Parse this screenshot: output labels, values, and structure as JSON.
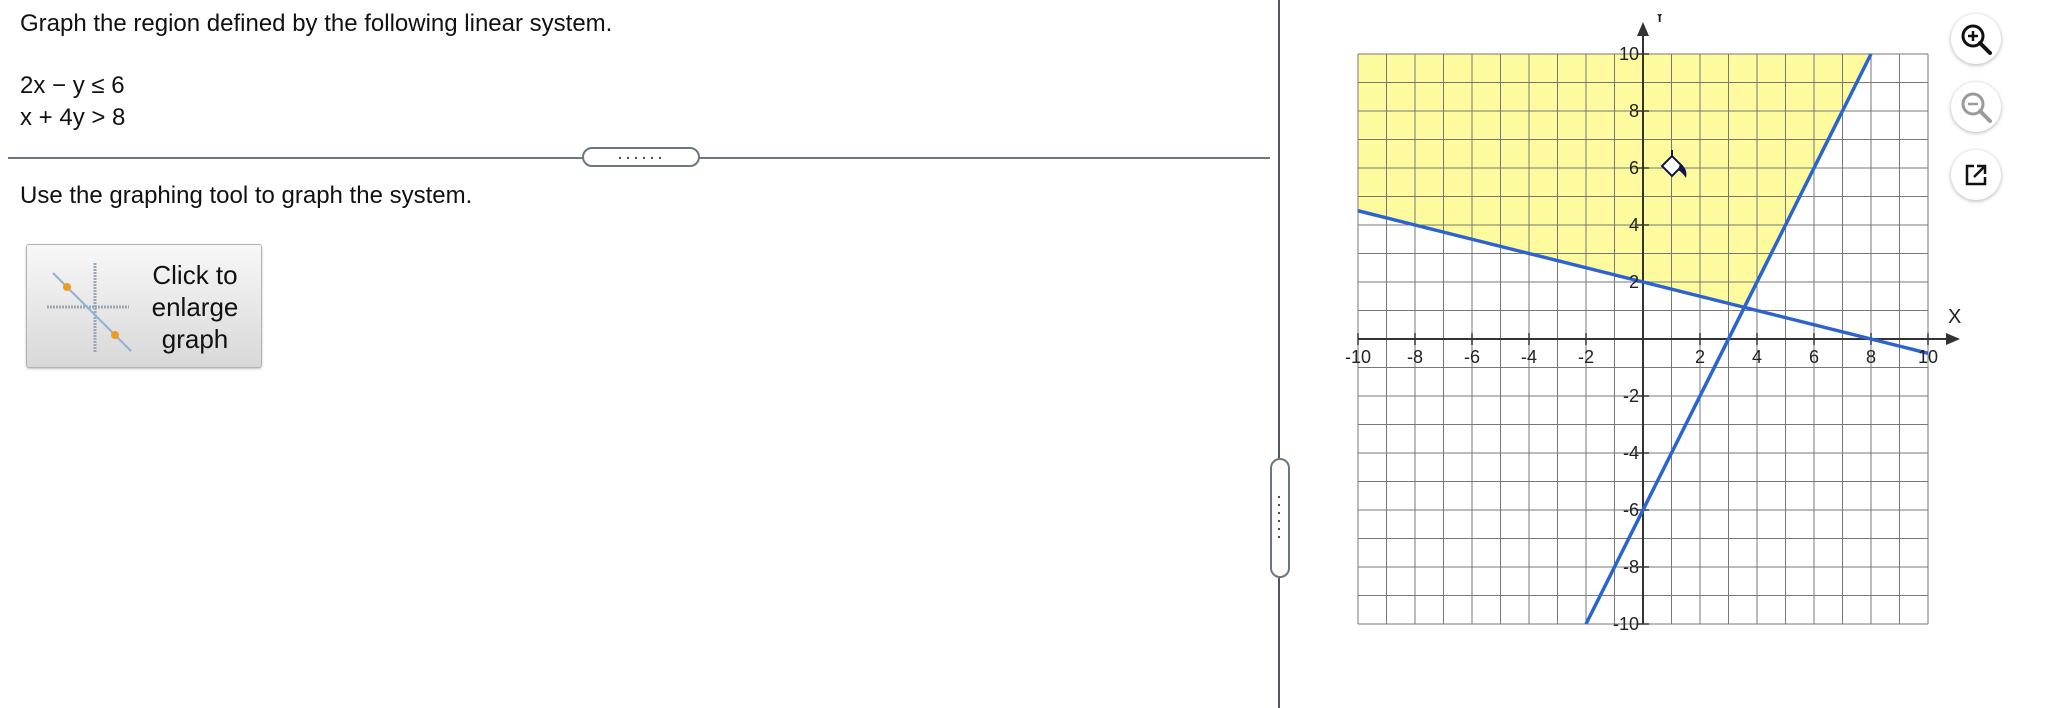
{
  "question": {
    "title": "Graph the region defined by the following linear system.",
    "inequalities": [
      "2x − y ≤ 6",
      "x + 4y > 8"
    ],
    "instruction": "Use the graphing tool to graph the system.",
    "enlarge_button_label": "Click to\nenlarge\ngraph",
    "divider_dots": "······"
  },
  "graph": {
    "x_axis_label": "X",
    "y_axis_label": "Y",
    "xlim": [
      -10,
      10
    ],
    "ylim": [
      -10,
      10
    ],
    "x_tick_labels": [
      -10,
      -8,
      -6,
      -4,
      -2,
      2,
      4,
      6,
      8,
      10
    ],
    "y_tick_labels": [
      10,
      8,
      6,
      4,
      2,
      -2,
      -4,
      -6,
      -8,
      -10
    ],
    "lines": [
      {
        "equation": "2x − y = 6",
        "slope": 2,
        "intercept": -6,
        "color": "#2b63d1"
      },
      {
        "equation": "x + 4y = 8",
        "slope": -0.25,
        "intercept": 2,
        "color": "#2b63d1"
      }
    ],
    "shaded_color": "#fdfb9d",
    "grid_color": "#777777"
  },
  "toolbar": {
    "zoom_in_icon": "zoom-in-icon",
    "zoom_out_icon": "zoom-out-icon",
    "popout_icon": "popout-icon"
  }
}
